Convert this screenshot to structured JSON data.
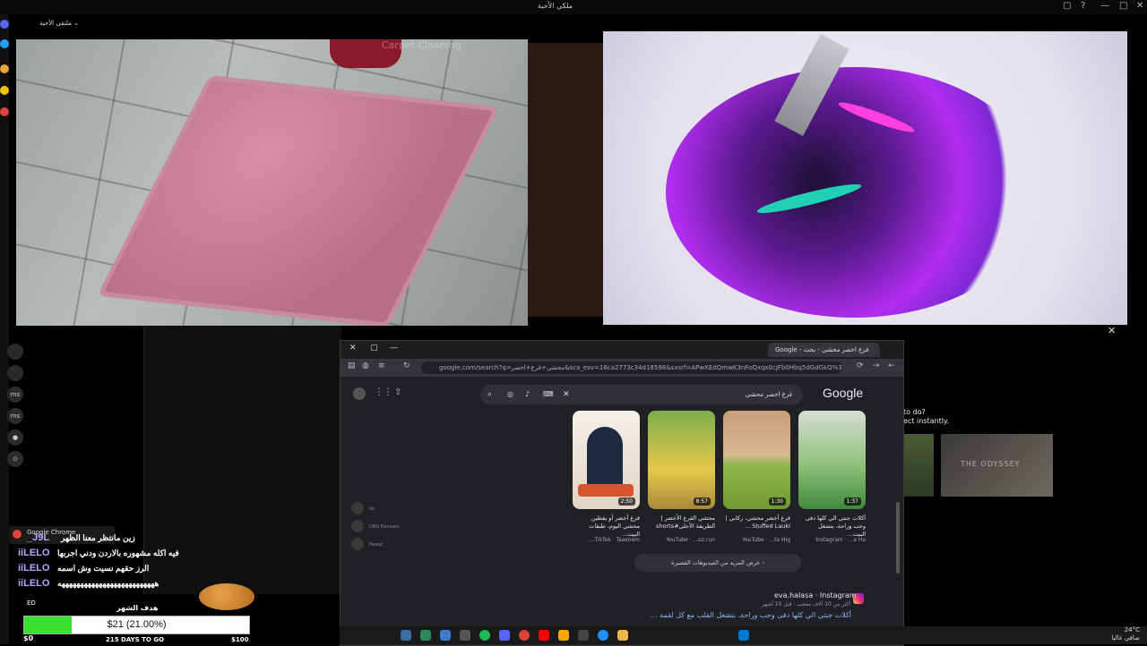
{
  "window": {
    "title": "ملكي الأحبة",
    "tab_label": "ملتقى الأحبة",
    "controls": [
      "▢",
      "?",
      "—",
      "□",
      "✕"
    ]
  },
  "videos": {
    "rug_overlay_title": "Carpet Cleaning",
    "close_symbol": "✕"
  },
  "browser": {
    "tab_title": "Google - فرع اخضر محشي - بحث",
    "url": "google.com/search?q=محشي+قرع+اخضر&sca_esv=16ca2773c34d18598&sxsrf=APwXEdQmwK3nFoQxqx0cjFb0Hbq5dGdGkQ%3A17681956592",
    "google_logo": "Google",
    "search_query": "قرع اخضر محشي",
    "videos": [
      {
        "caption": "قرع أخضر أو يقطين محشي اليوم، طبقات البيت...",
        "source": "TikTok · Taasnem...",
        "duration": "2:50"
      },
      {
        "caption": "محشي القرع الأخضر | الطريقة الأحلى#shorts",
        "source": "YouTube · ...oz.run",
        "duration": "8:57"
      },
      {
        "caption": "قرع أخضر محشي، ركابي | Stuffed Lauki ...",
        "source": "YouTube · ...ta Hig",
        "duration": "1:30"
      },
      {
        "caption": "أكلات جنتي الي كلها دفى وحب وراحة، بتشغل البيت...",
        "source": "Instagram · ...a Ha",
        "duration": "1:37"
      }
    ],
    "more_videos": "عرض المزيد من الفيديوهات القصيرة",
    "result_source": "eva.halasa · Instagram",
    "result_meta": "أكثر من 10 آلاف معجب · قبل 10 أشهر",
    "result_title": "أكلات جنتي الي كلها دفى وحب وراحة، بتشغل القلب مع كل لقمة ...",
    "side_names": [
      "ibi",
      "DNG Banaam",
      "Fawaz"
    ]
  },
  "behind": {
    "side_text": [
      "to do?",
      "ect instantly."
    ],
    "thumb_text": "THE ODYSSEY"
  },
  "chat": {
    "notification": "Google Chrome",
    "messages": [
      {
        "name": "_J9L",
        "text": "زين مانتظر معنا الظهر"
      },
      {
        "name": "iiLELO",
        "text": "فيه اكله مشهوره بالاردن ودني اجربها"
      },
      {
        "name": "iiLELO",
        "text": "الرز حقهم نسيت وش اسمه"
      },
      {
        "name": "iiLELO",
        "text": "ههههههههههههههههههههههههههه"
      }
    ]
  },
  "goal": {
    "label": "هدف الشهر",
    "text": "$21 (21.00%)",
    "fill_percent": 21,
    "left": "$0",
    "days": "215 DAYS TO GO",
    "right": "$100",
    "streamer": "ED"
  },
  "taskbar": {
    "clock_time": "24°C",
    "clock_date": "صافي غالبا"
  },
  "colors": {
    "goal_fill": "#39e12f",
    "chat_name": "#b4a9ff",
    "link_blue": "#8ab4f8"
  }
}
